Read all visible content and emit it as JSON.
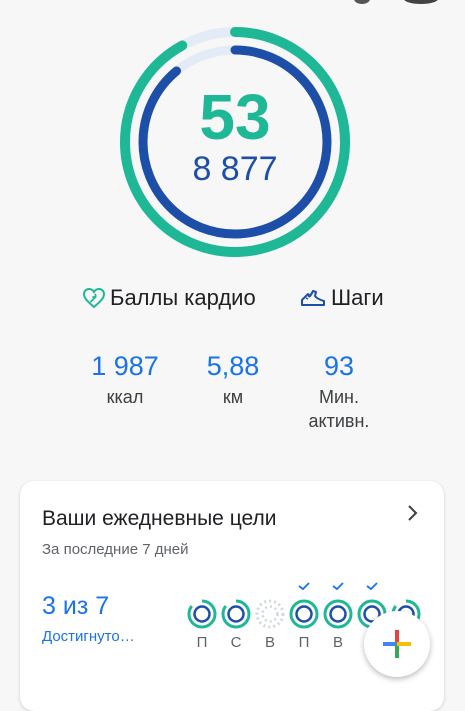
{
  "ring": {
    "cardio_points": "53",
    "steps": "8 877",
    "cardio_progress": 0.92,
    "steps_progress": 0.89
  },
  "legend": {
    "cardio_label": "Баллы кардио",
    "steps_label": "Шаги",
    "cardio_icon": "heart-cardio-icon",
    "steps_icon": "shoe-steps-icon"
  },
  "stats": {
    "kcal_value": "1 987",
    "kcal_label": "ккал",
    "km_value": "5,88",
    "km_label": "км",
    "minutes_value": "93",
    "minutes_label_1": "Мин.",
    "minutes_label_2": "активн."
  },
  "goals": {
    "title": "Ваши ежедневные цели",
    "subtitle": "За последние 7 дней",
    "count": "3 из 7",
    "achieved_label": "Достигнуто…",
    "days": [
      {
        "label": "П",
        "met": false
      },
      {
        "label": "С",
        "met": false
      },
      {
        "label": "В",
        "met": false
      },
      {
        "label": "П",
        "met": true
      },
      {
        "label": "В",
        "met": true
      },
      {
        "label": "",
        "met": true
      },
      {
        "label": "",
        "met": false
      }
    ]
  },
  "colors": {
    "cardio": "#1fb896",
    "steps": "#1d4fa8",
    "accent": "#1a73e8"
  }
}
